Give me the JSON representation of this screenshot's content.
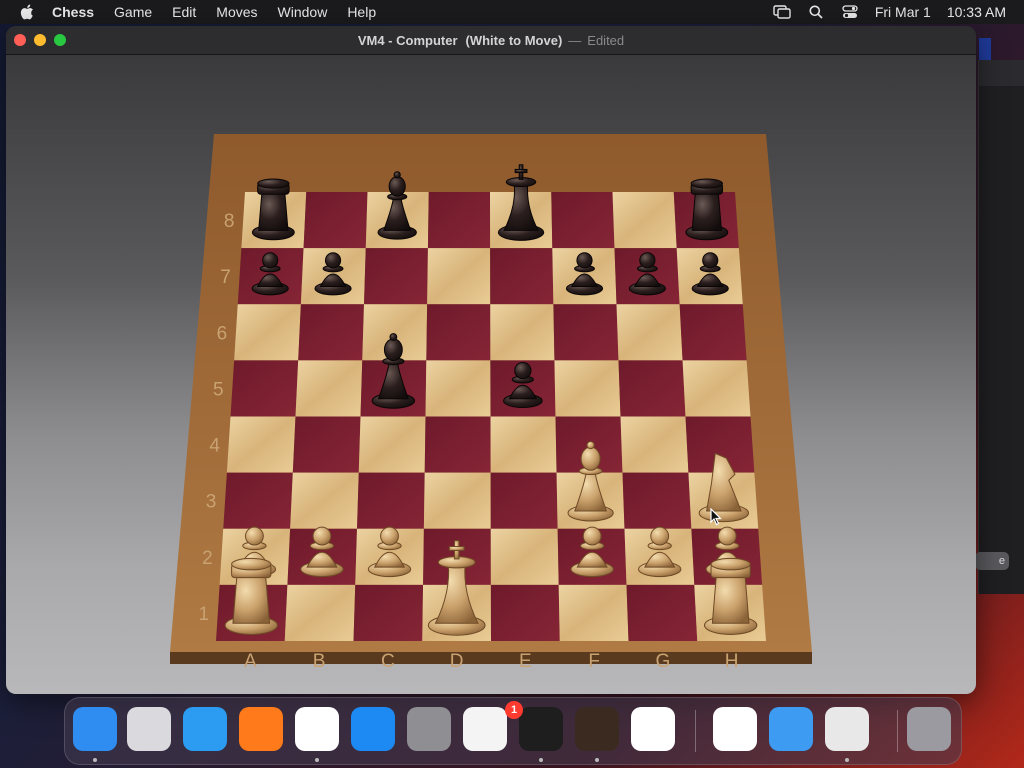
{
  "menubar": {
    "app_name": "Chess",
    "items": [
      "Game",
      "Edit",
      "Moves",
      "Window",
      "Help"
    ],
    "date": "Fri Mar 1",
    "time": "10:33 AM"
  },
  "window": {
    "title": "VM4 - Computer",
    "status": "(White to Move)",
    "separator": "—",
    "edited": "Edited"
  },
  "board": {
    "files": [
      "A",
      "B",
      "C",
      "D",
      "E",
      "F",
      "G",
      "H"
    ],
    "ranks": [
      "8",
      "7",
      "6",
      "5",
      "4",
      "3",
      "2",
      "1"
    ],
    "colors": {
      "dark": "#7a1e30",
      "light": "#e2c48f",
      "frame": "#a06a38"
    },
    "pieces": [
      {
        "color": "black",
        "type": "rook",
        "square": "a8"
      },
      {
        "color": "black",
        "type": "bishop",
        "square": "c8"
      },
      {
        "color": "black",
        "type": "king",
        "square": "e8"
      },
      {
        "color": "black",
        "type": "rook",
        "square": "h8"
      },
      {
        "color": "black",
        "type": "pawn",
        "square": "a7"
      },
      {
        "color": "black",
        "type": "pawn",
        "square": "b7"
      },
      {
        "color": "black",
        "type": "pawn",
        "square": "f7"
      },
      {
        "color": "black",
        "type": "pawn",
        "square": "g7"
      },
      {
        "color": "black",
        "type": "pawn",
        "square": "h7"
      },
      {
        "color": "black",
        "type": "bishop",
        "square": "c5"
      },
      {
        "color": "black",
        "type": "pawn",
        "square": "e5"
      },
      {
        "color": "white",
        "type": "bishop",
        "square": "f3"
      },
      {
        "color": "white",
        "type": "knight",
        "square": "h3"
      },
      {
        "color": "white",
        "type": "pawn",
        "square": "a2"
      },
      {
        "color": "white",
        "type": "pawn",
        "square": "b2"
      },
      {
        "color": "white",
        "type": "pawn",
        "square": "c2"
      },
      {
        "color": "white",
        "type": "pawn",
        "square": "f2"
      },
      {
        "color": "white",
        "type": "pawn",
        "square": "g2"
      },
      {
        "color": "white",
        "type": "pawn",
        "square": "h2"
      },
      {
        "color": "white",
        "type": "rook",
        "square": "a1"
      },
      {
        "color": "white",
        "type": "king",
        "square": "d1"
      },
      {
        "color": "white",
        "type": "rook",
        "square": "h1"
      }
    ]
  },
  "background_window": {
    "button_label": "e"
  },
  "dock": {
    "apps": [
      {
        "name": "finder-icon",
        "color": "#2f8cf0"
      },
      {
        "name": "launchpad-icon",
        "color": "#d9d9de"
      },
      {
        "name": "safari-icon",
        "color": "#2b9cf2"
      },
      {
        "name": "firefox-icon",
        "color": "#ff7a1a"
      },
      {
        "name": "chrome-icon",
        "color": "#ffffff"
      },
      {
        "name": "app-store-icon",
        "color": "#1c8af2"
      },
      {
        "name": "system-settings-icon",
        "color": "#8e8e93"
      },
      {
        "name": "textedit-icon",
        "color": "#f4f4f4"
      },
      {
        "name": "terminal-icon",
        "color": "#1e1e1e"
      },
      {
        "name": "garageband-icon",
        "color": "#3a2a20"
      },
      {
        "name": "vscode-icon",
        "color": "#ffffff"
      },
      {
        "name": "visual-studio-icon",
        "color": "#ffffff"
      },
      {
        "name": "weather-icon",
        "color": "#3d9cf2"
      },
      {
        "name": "chess-icon",
        "color": "#e8e8e8"
      },
      {
        "name": "trash-icon",
        "color": "#9a9aa0"
      }
    ],
    "settings_badge": "1"
  }
}
